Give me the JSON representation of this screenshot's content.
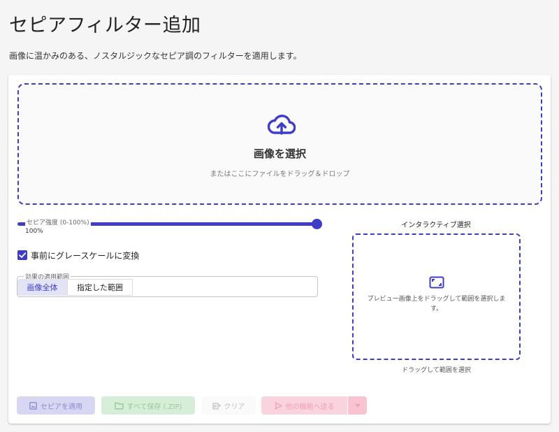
{
  "page": {
    "title": "セピアフィルター追加",
    "description": "画像に温かみのある、ノスタルジックなセピア調のフィルターを適用します。"
  },
  "dropzone": {
    "icon": "cloud-upload-icon",
    "title": "画像を選択",
    "subtitle": "またはここにファイルをドラッグ＆ドロップ"
  },
  "sepia_slider": {
    "label": "セピア強度 (0-100%)",
    "value_text": "100%",
    "value": 100
  },
  "grayscale_checkbox": {
    "label": "事前にグレースケールに変換",
    "checked": true
  },
  "apply_range": {
    "legend": "効果の適用範囲",
    "options": [
      "画像全体",
      "指定した範囲"
    ],
    "selected": "画像全体"
  },
  "interactive_selection": {
    "title": "インタラクティブ選択",
    "icon": "select-area-icon",
    "hint": "プレビュー画像上をドラッグして範囲を選択します。",
    "caption": "ドラッグして範囲を選択"
  },
  "actions": {
    "apply_label": "セピアを適用",
    "save_all_label": "すべて保存 (.ZIP)",
    "clear_label": "クリア",
    "send_label": "他の機能へ送る"
  },
  "colors": {
    "accent": "#3f3dc8",
    "background": "#f5f5f5"
  }
}
